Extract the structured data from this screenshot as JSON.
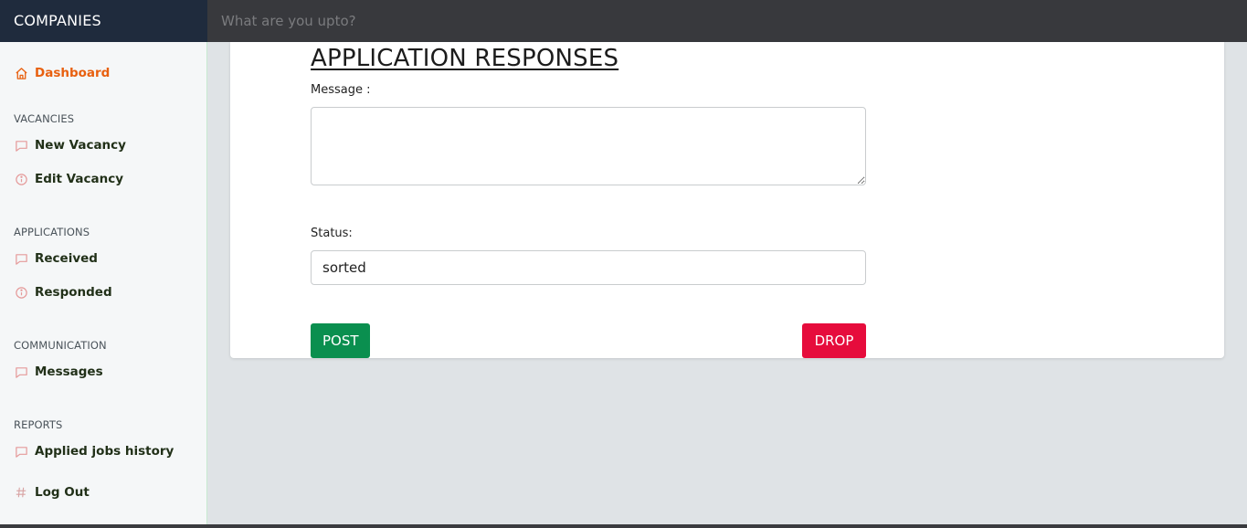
{
  "header": {
    "brand": "COMPANIES",
    "search_placeholder": "What are you upto?"
  },
  "sidebar": {
    "dashboard": "Dashboard",
    "sections": {
      "vacancies": "VACANCIES",
      "applications": "APPLICATIONS",
      "communication": "COMMUNICATION",
      "reports": "REPORTS"
    },
    "items": {
      "new_vacancy": "New Vacancy",
      "edit_vacancy": "Edit Vacancy",
      "received": "Received",
      "responded": "Responded",
      "messages": "Messages",
      "applied_jobs_history": "Applied jobs history",
      "log_out": "Log Out"
    },
    "icons": {
      "dashboard": "home-icon",
      "new_vacancy": "message-icon",
      "edit_vacancy": "info-icon",
      "received": "message-icon",
      "responded": "info-icon",
      "messages": "message-icon",
      "applied_jobs_history": "message-icon",
      "log_out": "hash-icon"
    },
    "active_color": "#e8600f"
  },
  "form": {
    "title": "APPLICATION RESPONSES",
    "message_label": "Message :",
    "message_value": "",
    "status_label": "Status:",
    "status_value": "sorted",
    "post_label": "POST",
    "drop_label": "DROP"
  },
  "colors": {
    "post": "#0a8f4f",
    "drop": "#e60c3c",
    "brand_bg": "#1f2b3d",
    "topbar_bg": "#38393d"
  }
}
